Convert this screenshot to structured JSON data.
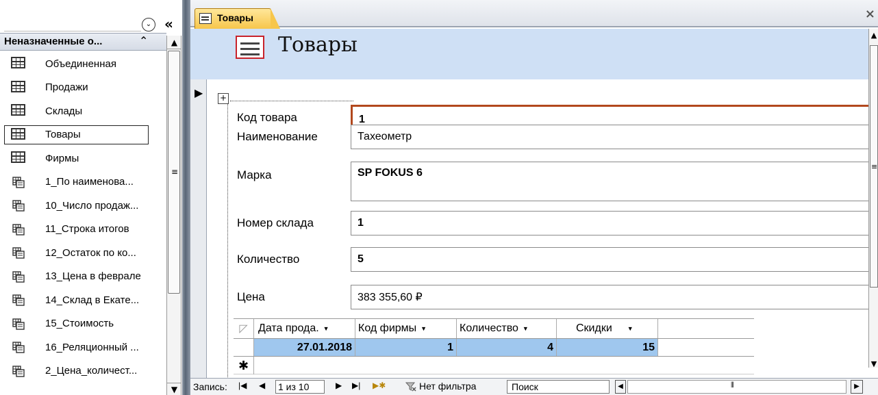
{
  "nav": {
    "group_label": "Неназначенные о...",
    "group_arrow": "⌃",
    "collapse_label": "«",
    "menu_glyph": "⌄",
    "items": [
      {
        "label": "Объединенная",
        "type": "table"
      },
      {
        "label": "Продажи",
        "type": "table"
      },
      {
        "label": "Склады",
        "type": "table"
      },
      {
        "label": "Товары",
        "type": "table",
        "selected": true
      },
      {
        "label": "Фирмы",
        "type": "table"
      },
      {
        "label": "1_По наименова...",
        "type": "query"
      },
      {
        "label": "10_Число продаж...",
        "type": "query"
      },
      {
        "label": "11_Строка итогов",
        "type": "query"
      },
      {
        "label": "12_Остаток по ко...",
        "type": "query"
      },
      {
        "label": "13_Цена в феврале",
        "type": "query"
      },
      {
        "label": "14_Склад в Екате...",
        "type": "query"
      },
      {
        "label": "15_Стоимость",
        "type": "query"
      },
      {
        "label": "16_Реляционный ...",
        "type": "query"
      },
      {
        "label": "2_Цена_количест...",
        "type": "query"
      }
    ]
  },
  "tab": {
    "label": "Товары",
    "close": "×"
  },
  "form": {
    "title": "Товары",
    "fields": [
      {
        "label": "Код товара",
        "value": "1"
      },
      {
        "label": "Наименование",
        "value": "Тахеометр"
      },
      {
        "label": "Марка",
        "value": "SP FOKUS 6"
      },
      {
        "label": "Номер склада",
        "value": "1"
      },
      {
        "label": "Количество",
        "value": "5"
      },
      {
        "label": "Цена",
        "value": "383 355,60 ₽"
      }
    ],
    "subform": {
      "columns": [
        "Дата прода.",
        "Код фирмы",
        "Количество",
        "Скидки"
      ],
      "row": [
        "27.01.2018",
        "1",
        "4",
        "15"
      ],
      "new_row_marker": "✱"
    }
  },
  "status": {
    "record_label": "Запись:",
    "record_counter": "1 из 10",
    "filter_label": "Нет фильтра",
    "search_label": "Поиск"
  },
  "colors": {
    "header_bg": "#cfe0f5",
    "tab_active": "#f7c64b",
    "focus_border": "#b2481d",
    "row_selected": "#9fc7ee"
  }
}
